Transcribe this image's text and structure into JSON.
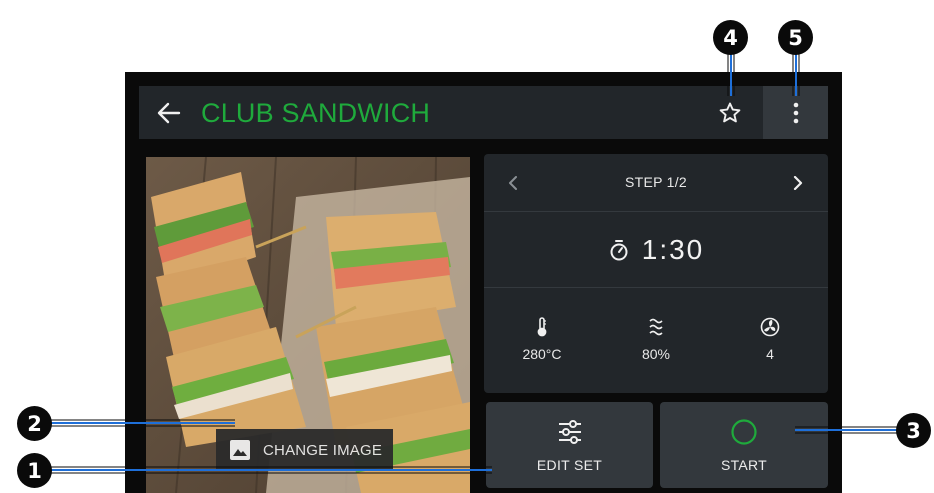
{
  "header": {
    "back_icon": "arrow-left-icon",
    "title": "CLUB SANDWICH",
    "title_color": "#1faa3c",
    "favorite_icon": "star-outline-icon",
    "menu_icon": "more-vertical-icon"
  },
  "image": {
    "subject": "club sandwich photo",
    "change_image_label": "CHANGE IMAGE",
    "change_image_icon": "image-icon"
  },
  "step": {
    "prev_icon": "chevron-left-icon",
    "next_icon": "chevron-right-icon",
    "label": "STEP 1/2",
    "timer_icon": "stopwatch-icon",
    "timer_value": "1:30",
    "params": [
      {
        "icon": "thermometer-icon",
        "value": "280°C"
      },
      {
        "icon": "humidity-icon",
        "value": "80%"
      },
      {
        "icon": "fan-icon",
        "value": "4"
      }
    ]
  },
  "actions": {
    "edit_set_label": "EDIT SET",
    "edit_set_icon": "sliders-icon",
    "start_label": "START",
    "start_icon": "circle-icon",
    "start_icon_color": "#1faa3c"
  },
  "callouts": [
    "1",
    "2",
    "3",
    "4",
    "5"
  ],
  "colors": {
    "background": "#0a0a0a",
    "panel": "#22262a",
    "button": "#33383d",
    "callout_line": "#1e6fd9"
  }
}
